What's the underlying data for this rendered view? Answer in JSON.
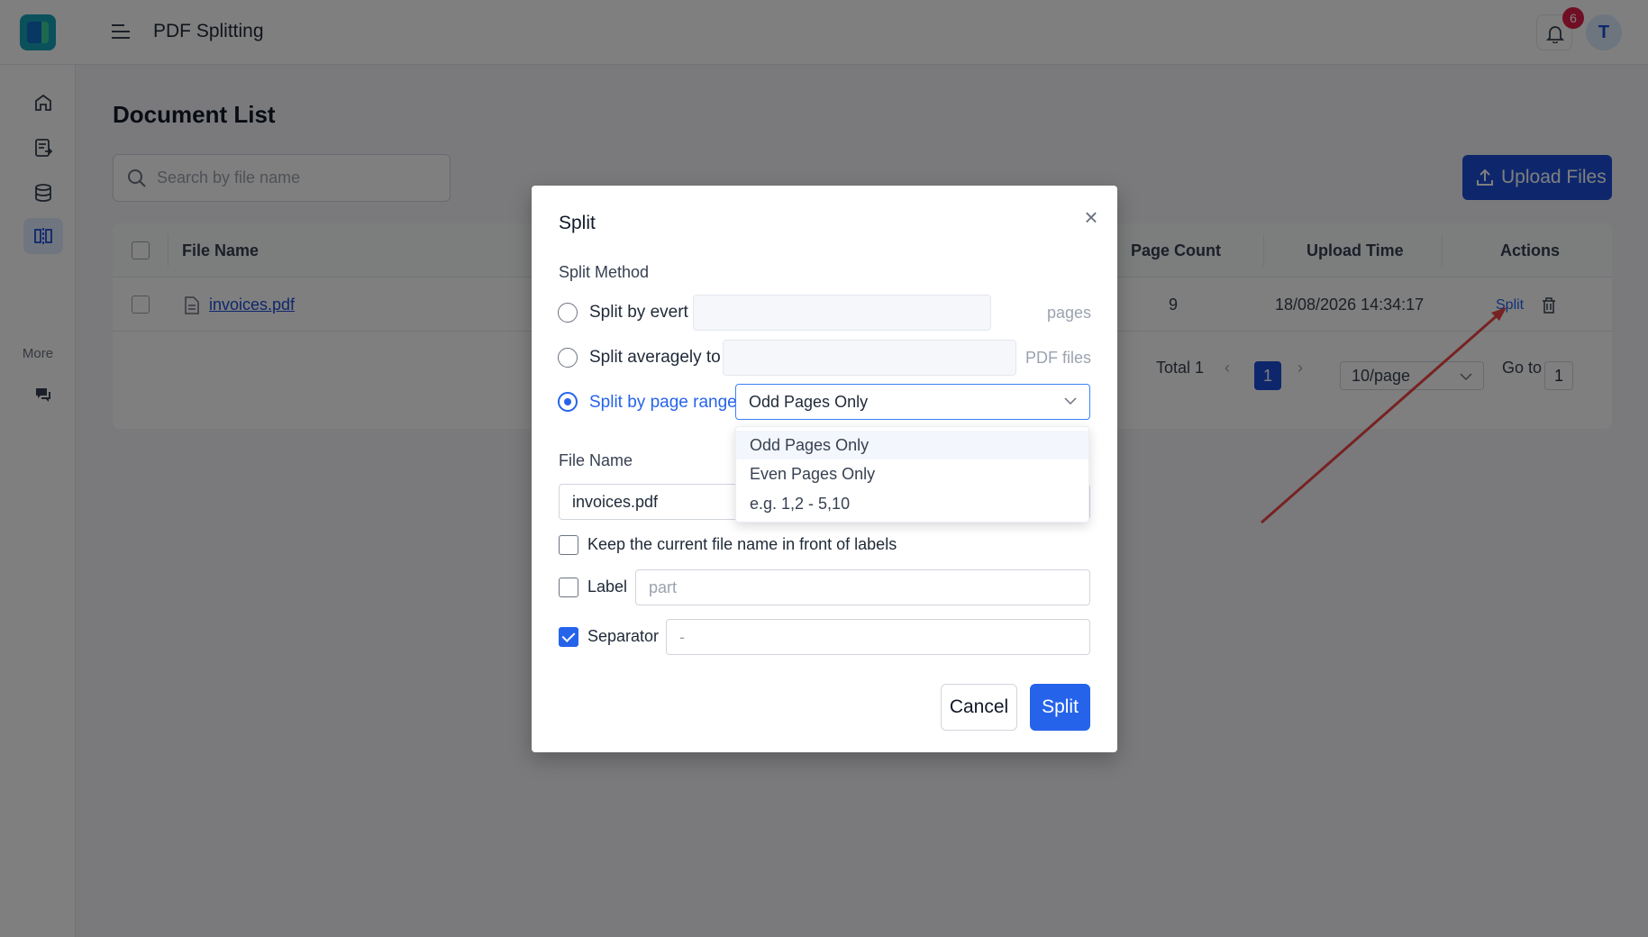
{
  "app": {
    "title": "PDF Splitting"
  },
  "header": {
    "notification_count": "6",
    "avatar_initial": "T"
  },
  "sidebar": {
    "items": [
      {
        "icon": "home-icon"
      },
      {
        "icon": "document-convert-icon"
      },
      {
        "icon": "database-icon"
      },
      {
        "icon": "split-icon",
        "active": true
      }
    ],
    "more_label": "More",
    "extra_icon": "chat-icon"
  },
  "main": {
    "page_title": "Document List",
    "search": {
      "placeholder": "Search by file name"
    },
    "upload_label": "Upload Files",
    "table": {
      "columns": [
        "File Name",
        "Page Count",
        "Upload Time",
        "Actions"
      ],
      "rows": [
        {
          "file_name": "invoices.pdf",
          "page_count": "9",
          "upload_time": "18/08/2026 14:34:17",
          "action": "Split"
        }
      ]
    },
    "pagination": {
      "total": "Total 1",
      "current_page": "1",
      "per_page": "10/page",
      "goto_label": "Go to",
      "goto_value": "1"
    }
  },
  "modal": {
    "title": "Split",
    "split_method_label": "Split Method",
    "options": {
      "every_label": "Split by evert",
      "every_suffix": "pages",
      "average_label": "Split averagely to",
      "average_suffix": "PDF files",
      "range_label": "Split by page range",
      "range_value": "Odd Pages Only"
    },
    "dropdown_options": [
      "Odd Pages Only",
      "Even Pages Only",
      "e.g. 1,2 - 5,10"
    ],
    "file_name_label": "File Name",
    "file_name_value": "invoices.pdf",
    "keep_name_label": "Keep the current file name in front of labels",
    "label_label": "Label",
    "label_placeholder": "part",
    "separator_label": "Separator",
    "separator_value": "-",
    "cancel_label": "Cancel",
    "split_label": "Split"
  },
  "colors": {
    "primary": "#2563eb",
    "brand_dark": "#1d4ed8",
    "badge": "#e11d48",
    "annotation_arrow": "#ef4444"
  }
}
